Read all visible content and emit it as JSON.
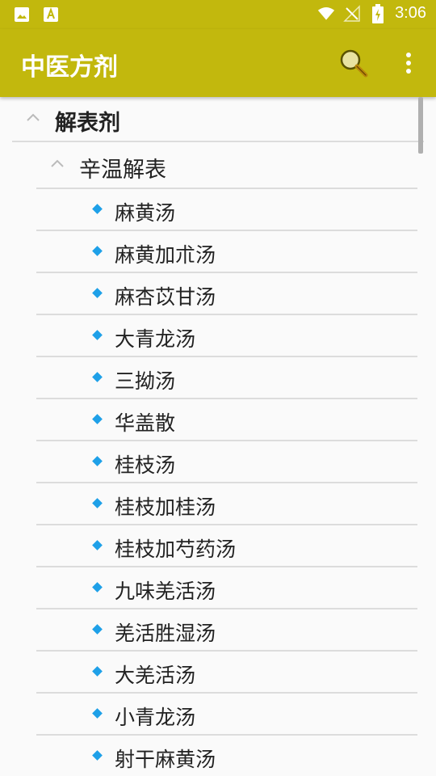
{
  "status_bar": {
    "time": "3:06",
    "icons": [
      "image-icon",
      "text-a-icon",
      "wifi-icon",
      "no-signal-icon",
      "battery-charging-icon"
    ]
  },
  "app_bar": {
    "title": "中医方剂",
    "actions": [
      "search-icon",
      "more-vert-icon"
    ],
    "color": "#c2b80d"
  },
  "tree": {
    "group": {
      "label": "解表剂",
      "expanded": true,
      "subgroup": {
        "label": "辛温解表",
        "expanded": true,
        "items": [
          "麻黄汤",
          "麻黄加朮汤",
          "麻杏苡甘汤",
          "大青龙汤",
          "三拗汤",
          "华盖散",
          "桂枝汤",
          "桂枝加桂汤",
          "桂枝加芍药汤",
          "九味羌活汤",
          "羌活胜湿汤",
          "大羌活汤",
          "小青龙汤",
          "射干麻黄汤"
        ]
      }
    },
    "bullet_color": "#1ea0e8"
  }
}
